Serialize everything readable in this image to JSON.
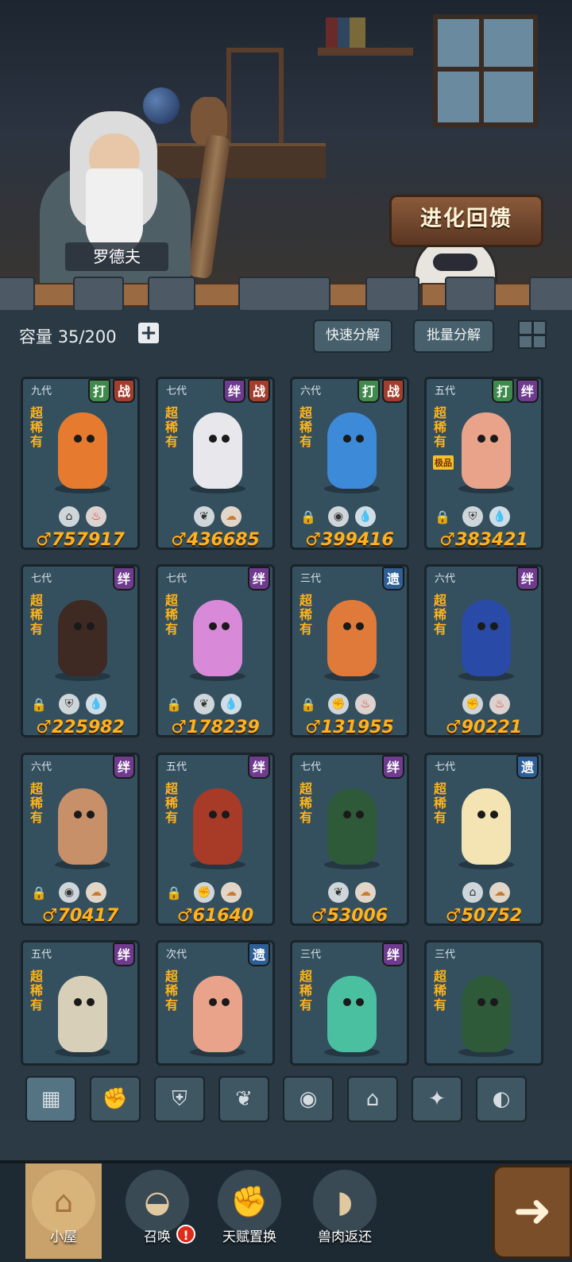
{
  "npc": {
    "name": "罗德夫"
  },
  "evolve_button": "进化回馈",
  "header": {
    "capacity_label": "容量",
    "capacity_value": "35/200",
    "quick_decompose": "快速分解",
    "batch_decompose": "批量分解"
  },
  "cards": [
    {
      "gen": "九代",
      "tags": [
        "打",
        "战"
      ],
      "rarity": "超稀有",
      "elements": [
        "crest",
        "fire"
      ],
      "locked": false,
      "power": "757917",
      "color": "#e67a2e"
    },
    {
      "gen": "七代",
      "tags": [
        "绊",
        "战"
      ],
      "rarity": "超稀有",
      "elements": [
        "leaf",
        "earth"
      ],
      "locked": false,
      "power": "436685",
      "color": "#e8e8ec"
    },
    {
      "gen": "六代",
      "tags": [
        "打",
        "战"
      ],
      "rarity": "超稀有",
      "elements": [
        "alien",
        "water"
      ],
      "locked": true,
      "power": "399416",
      "color": "#3c8ad8"
    },
    {
      "gen": "五代",
      "tags": [
        "打",
        "绊"
      ],
      "rarity": "超稀有",
      "badge": "极品",
      "elements": [
        "shield",
        "water"
      ],
      "locked": true,
      "power": "383421",
      "color": "#e9a38a"
    },
    {
      "gen": "七代",
      "tags": [
        "绊"
      ],
      "rarity": "超稀有",
      "elements": [
        "shield",
        "water"
      ],
      "locked": true,
      "power": "225982",
      "color": "#3e2a22"
    },
    {
      "gen": "七代",
      "tags": [
        "绊"
      ],
      "rarity": "超稀有",
      "elements": [
        "leaf",
        "water"
      ],
      "locked": true,
      "power": "178239",
      "color": "#d88ad8"
    },
    {
      "gen": "三代",
      "tags": [
        "遗"
      ],
      "rarity": "超稀有",
      "elements": [
        "fist",
        "fire"
      ],
      "locked": true,
      "power": "131955",
      "color": "#e07a3a"
    },
    {
      "gen": "六代",
      "tags": [
        "绊"
      ],
      "rarity": "超稀有",
      "elements": [
        "fist",
        "fire"
      ],
      "locked": false,
      "power": "90221",
      "color": "#2a4aa8"
    },
    {
      "gen": "六代",
      "tags": [
        "绊"
      ],
      "rarity": "超稀有",
      "elements": [
        "alien",
        "earth"
      ],
      "locked": true,
      "power": "70417",
      "color": "#c89068"
    },
    {
      "gen": "五代",
      "tags": [
        "绊"
      ],
      "rarity": "超稀有",
      "elements": [
        "fist",
        "earth"
      ],
      "locked": true,
      "power": "61640",
      "color": "#a83a28"
    },
    {
      "gen": "七代",
      "tags": [
        "绊"
      ],
      "rarity": "超稀有",
      "elements": [
        "leaf",
        "earth"
      ],
      "locked": false,
      "power": "53006",
      "color": "#2e5a3a"
    },
    {
      "gen": "七代",
      "tags": [
        "遗"
      ],
      "rarity": "超稀有",
      "elements": [
        "crest",
        "earth"
      ],
      "locked": false,
      "power": "50752",
      "color": "#f4e4b4"
    },
    {
      "gen": "五代",
      "tags": [
        "绊"
      ],
      "rarity": "超稀有",
      "elements": [],
      "locked": false,
      "power": "",
      "color": "#d8cfb8"
    },
    {
      "gen": "次代",
      "tags": [
        "遗"
      ],
      "rarity": "超稀有",
      "elements": [],
      "locked": false,
      "power": "",
      "color": "#e9a38a"
    },
    {
      "gen": "三代",
      "tags": [
        "绊"
      ],
      "rarity": "超稀有",
      "elements": [],
      "locked": false,
      "power": "",
      "color": "#4ac0a0"
    },
    {
      "gen": "三代",
      "tags": [],
      "rarity": "超稀有",
      "elements": [],
      "locked": false,
      "power": "",
      "color": "#2e5a3a"
    }
  ],
  "filters": [
    {
      "icon": "all-icon",
      "glyph": "▦"
    },
    {
      "icon": "fist-icon",
      "glyph": "✊"
    },
    {
      "icon": "shield-icon",
      "glyph": "⛨"
    },
    {
      "icon": "leaf-icon",
      "glyph": "❦"
    },
    {
      "icon": "alien-icon",
      "glyph": "◉"
    },
    {
      "icon": "crest-icon",
      "glyph": "⌂"
    },
    {
      "icon": "star-icon",
      "glyph": "✦"
    },
    {
      "icon": "eye-icon",
      "glyph": "◐"
    }
  ],
  "nav": [
    {
      "label": "小屋",
      "icon": "hut-icon",
      "glyph": "⌂"
    },
    {
      "label": "召唤",
      "icon": "egg-icon",
      "glyph": "◒"
    },
    {
      "label": "天赋置换",
      "icon": "fist-icon",
      "glyph": "✊"
    },
    {
      "label": "兽肉返还",
      "icon": "meat-icon",
      "glyph": "◗"
    }
  ],
  "alert_glyph": "!",
  "go_glyph": "➜",
  "colors": {
    "power": "#ffb21e",
    "rarity": "#ffb31a",
    "card_bg": "#34505f",
    "page_bg": "#2a3943"
  }
}
